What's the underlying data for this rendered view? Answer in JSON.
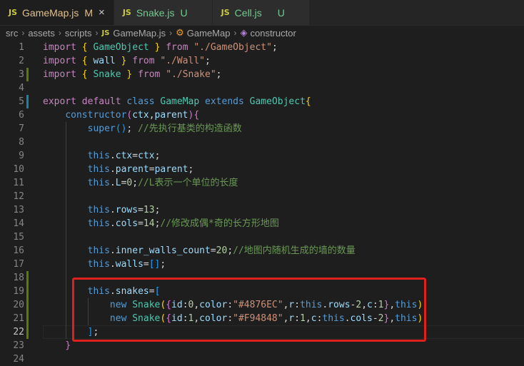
{
  "tabs": [
    {
      "label": "GameMap.js",
      "status": "M",
      "active": true,
      "close": "×",
      "icon": "js-file-icon"
    },
    {
      "label": "Snake.js",
      "status": "U",
      "active": false,
      "icon": "js-file-icon"
    },
    {
      "label": "Cell.js",
      "status": "U",
      "active": false,
      "icon": "js-file-icon"
    }
  ],
  "file_badge": "JS",
  "breadcrumb": {
    "items": [
      "src",
      "assets",
      "scripts",
      "GameMap.js",
      "GameMap",
      "constructor"
    ],
    "separator": "›"
  },
  "editor": {
    "current_line": 22,
    "lines": [
      {
        "n": "1",
        "tokens": [
          [
            "kw",
            "import"
          ],
          [
            "pun",
            " "
          ],
          [
            "b1",
            "{"
          ],
          [
            "pun",
            " "
          ],
          [
            "cls",
            "GameObject"
          ],
          [
            "pun",
            " "
          ],
          [
            "b1",
            "}"
          ],
          [
            "pun",
            " "
          ],
          [
            "kw",
            "from"
          ],
          [
            "pun",
            " "
          ],
          [
            "str",
            "\"./GameObject\""
          ],
          [
            "pun",
            ";"
          ]
        ]
      },
      {
        "n": "2",
        "tokens": [
          [
            "kw",
            "import"
          ],
          [
            "pun",
            " "
          ],
          [
            "b1",
            "{"
          ],
          [
            "pun",
            " "
          ],
          [
            "var",
            "wall"
          ],
          [
            "pun",
            " "
          ],
          [
            "b1",
            "}"
          ],
          [
            "pun",
            " "
          ],
          [
            "kw",
            "from"
          ],
          [
            "pun",
            " "
          ],
          [
            "str",
            "\"./Wall\""
          ],
          [
            "pun",
            ";"
          ]
        ]
      },
      {
        "n": "3",
        "git": "add",
        "tokens": [
          [
            "kw",
            "import"
          ],
          [
            "pun",
            " "
          ],
          [
            "b1",
            "{"
          ],
          [
            "pun",
            " "
          ],
          [
            "cls",
            "Snake"
          ],
          [
            "pun",
            " "
          ],
          [
            "b1",
            "}"
          ],
          [
            "pun",
            " "
          ],
          [
            "kw",
            "from"
          ],
          [
            "pun",
            " "
          ],
          [
            "str",
            "\"./Snake\""
          ],
          [
            "pun",
            ";"
          ]
        ]
      },
      {
        "n": "4",
        "tokens": []
      },
      {
        "n": "5",
        "git": "mod",
        "tokens": [
          [
            "kw",
            "export"
          ],
          [
            "pun",
            " "
          ],
          [
            "kw",
            "default"
          ],
          [
            "pun",
            " "
          ],
          [
            "kb",
            "class"
          ],
          [
            "pun",
            " "
          ],
          [
            "cls",
            "GameMap"
          ],
          [
            "pun",
            " "
          ],
          [
            "kb",
            "extends"
          ],
          [
            "pun",
            " "
          ],
          [
            "cls",
            "GameObject"
          ],
          [
            "b1",
            "{"
          ]
        ]
      },
      {
        "n": "6",
        "tokens": [
          [
            "pun",
            "    "
          ],
          [
            "kb",
            "constructor"
          ],
          [
            "b2",
            "("
          ],
          [
            "var",
            "ctx"
          ],
          [
            "pun",
            ","
          ],
          [
            "var",
            "parent"
          ],
          [
            "b2",
            ")"
          ],
          [
            "b2",
            "{"
          ]
        ]
      },
      {
        "n": "7",
        "tokens": [
          [
            "pun",
            "        "
          ],
          [
            "kb",
            "super"
          ],
          [
            "b3",
            "()"
          ],
          [
            "pun",
            "; "
          ],
          [
            "cmt",
            "//先执行基类的构造函数"
          ]
        ]
      },
      {
        "n": "8",
        "tokens": []
      },
      {
        "n": "9",
        "tokens": [
          [
            "pun",
            "        "
          ],
          [
            "kb",
            "this"
          ],
          [
            "pun",
            "."
          ],
          [
            "var",
            "ctx"
          ],
          [
            "pun",
            "="
          ],
          [
            "var",
            "ctx"
          ],
          [
            "pun",
            ";"
          ]
        ]
      },
      {
        "n": "10",
        "tokens": [
          [
            "pun",
            "        "
          ],
          [
            "kb",
            "this"
          ],
          [
            "pun",
            "."
          ],
          [
            "var",
            "parent"
          ],
          [
            "pun",
            "="
          ],
          [
            "var",
            "parent"
          ],
          [
            "pun",
            ";"
          ]
        ]
      },
      {
        "n": "11",
        "tokens": [
          [
            "pun",
            "        "
          ],
          [
            "kb",
            "this"
          ],
          [
            "pun",
            "."
          ],
          [
            "var",
            "L"
          ],
          [
            "pun",
            "="
          ],
          [
            "num",
            "0"
          ],
          [
            "pun",
            ";"
          ],
          [
            "cmt",
            "//L表示一个单位的长度"
          ]
        ]
      },
      {
        "n": "12",
        "tokens": []
      },
      {
        "n": "13",
        "tokens": [
          [
            "pun",
            "        "
          ],
          [
            "kb",
            "this"
          ],
          [
            "pun",
            "."
          ],
          [
            "var",
            "rows"
          ],
          [
            "pun",
            "="
          ],
          [
            "num",
            "13"
          ],
          [
            "pun",
            ";"
          ]
        ]
      },
      {
        "n": "14",
        "tokens": [
          [
            "pun",
            "        "
          ],
          [
            "kb",
            "this"
          ],
          [
            "pun",
            "."
          ],
          [
            "var",
            "cols"
          ],
          [
            "pun",
            "="
          ],
          [
            "num",
            "14"
          ],
          [
            "pun",
            ";"
          ],
          [
            "cmt",
            "//修改成偶*奇的长方形地图"
          ]
        ]
      },
      {
        "n": "15",
        "tokens": []
      },
      {
        "n": "16",
        "tokens": [
          [
            "pun",
            "        "
          ],
          [
            "kb",
            "this"
          ],
          [
            "pun",
            "."
          ],
          [
            "var",
            "inner_walls_count"
          ],
          [
            "pun",
            "="
          ],
          [
            "num",
            "20"
          ],
          [
            "pun",
            ";"
          ],
          [
            "cmt",
            "//地图内随机生成的墙的数量"
          ]
        ]
      },
      {
        "n": "17",
        "tokens": [
          [
            "pun",
            "        "
          ],
          [
            "kb",
            "this"
          ],
          [
            "pun",
            "."
          ],
          [
            "var",
            "walls"
          ],
          [
            "pun",
            "="
          ],
          [
            "b3",
            "[]"
          ],
          [
            "pun",
            ";"
          ]
        ]
      },
      {
        "n": "18",
        "git": "add",
        "tokens": []
      },
      {
        "n": "19",
        "git": "add",
        "tokens": [
          [
            "pun",
            "        "
          ],
          [
            "kb",
            "this"
          ],
          [
            "pun",
            "."
          ],
          [
            "var",
            "snakes"
          ],
          [
            "pun",
            "="
          ],
          [
            "b3",
            "["
          ]
        ]
      },
      {
        "n": "20",
        "git": "add",
        "tokens": [
          [
            "pun",
            "            "
          ],
          [
            "kb",
            "new"
          ],
          [
            "pun",
            " "
          ],
          [
            "cls",
            "Snake"
          ],
          [
            "b1",
            "("
          ],
          [
            "b2",
            "{"
          ],
          [
            "var",
            "id"
          ],
          [
            "pun",
            ":"
          ],
          [
            "num",
            "0"
          ],
          [
            "pun",
            ","
          ],
          [
            "var",
            "color"
          ],
          [
            "pun",
            ":"
          ],
          [
            "str",
            "\"#4876EC\""
          ],
          [
            "pun",
            ","
          ],
          [
            "var",
            "r"
          ],
          [
            "pun",
            ":"
          ],
          [
            "kb",
            "this"
          ],
          [
            "pun",
            "."
          ],
          [
            "var",
            "rows"
          ],
          [
            "pun",
            "-"
          ],
          [
            "num",
            "2"
          ],
          [
            "pun",
            ","
          ],
          [
            "var",
            "c"
          ],
          [
            "pun",
            ":"
          ],
          [
            "num",
            "1"
          ],
          [
            "b2",
            "}"
          ],
          [
            "pun",
            ","
          ],
          [
            "kb",
            "this"
          ],
          [
            "b1",
            ")"
          ],
          [
            "pun",
            ","
          ]
        ]
      },
      {
        "n": "21",
        "git": "add",
        "tokens": [
          [
            "pun",
            "            "
          ],
          [
            "kb",
            "new"
          ],
          [
            "pun",
            " "
          ],
          [
            "cls",
            "Snake"
          ],
          [
            "b1",
            "("
          ],
          [
            "b2",
            "{"
          ],
          [
            "var",
            "id"
          ],
          [
            "pun",
            ":"
          ],
          [
            "num",
            "1"
          ],
          [
            "pun",
            ","
          ],
          [
            "var",
            "color"
          ],
          [
            "pun",
            ":"
          ],
          [
            "str",
            "\"#F94848\""
          ],
          [
            "pun",
            ","
          ],
          [
            "var",
            "r"
          ],
          [
            "pun",
            ":"
          ],
          [
            "num",
            "1"
          ],
          [
            "pun",
            ","
          ],
          [
            "var",
            "c"
          ],
          [
            "pun",
            ":"
          ],
          [
            "kb",
            "this"
          ],
          [
            "pun",
            "."
          ],
          [
            "var",
            "cols"
          ],
          [
            "pun",
            "-"
          ],
          [
            "num",
            "2"
          ],
          [
            "b2",
            "}"
          ],
          [
            "pun",
            ","
          ],
          [
            "kb",
            "this"
          ],
          [
            "b1",
            ")"
          ],
          [
            "pun",
            ","
          ]
        ]
      },
      {
        "n": "22",
        "git": "add",
        "tokens": [
          [
            "pun",
            "        "
          ],
          [
            "b3",
            "]"
          ],
          [
            "pun",
            ";"
          ]
        ]
      },
      {
        "n": "23",
        "tokens": [
          [
            "pun",
            "    "
          ],
          [
            "b2",
            "}"
          ]
        ]
      },
      {
        "n": "24",
        "tokens": []
      }
    ]
  },
  "colors": {
    "highlight_box": "#e0201c",
    "git_added": "#587c0c",
    "git_modified": "#1b81a8"
  }
}
